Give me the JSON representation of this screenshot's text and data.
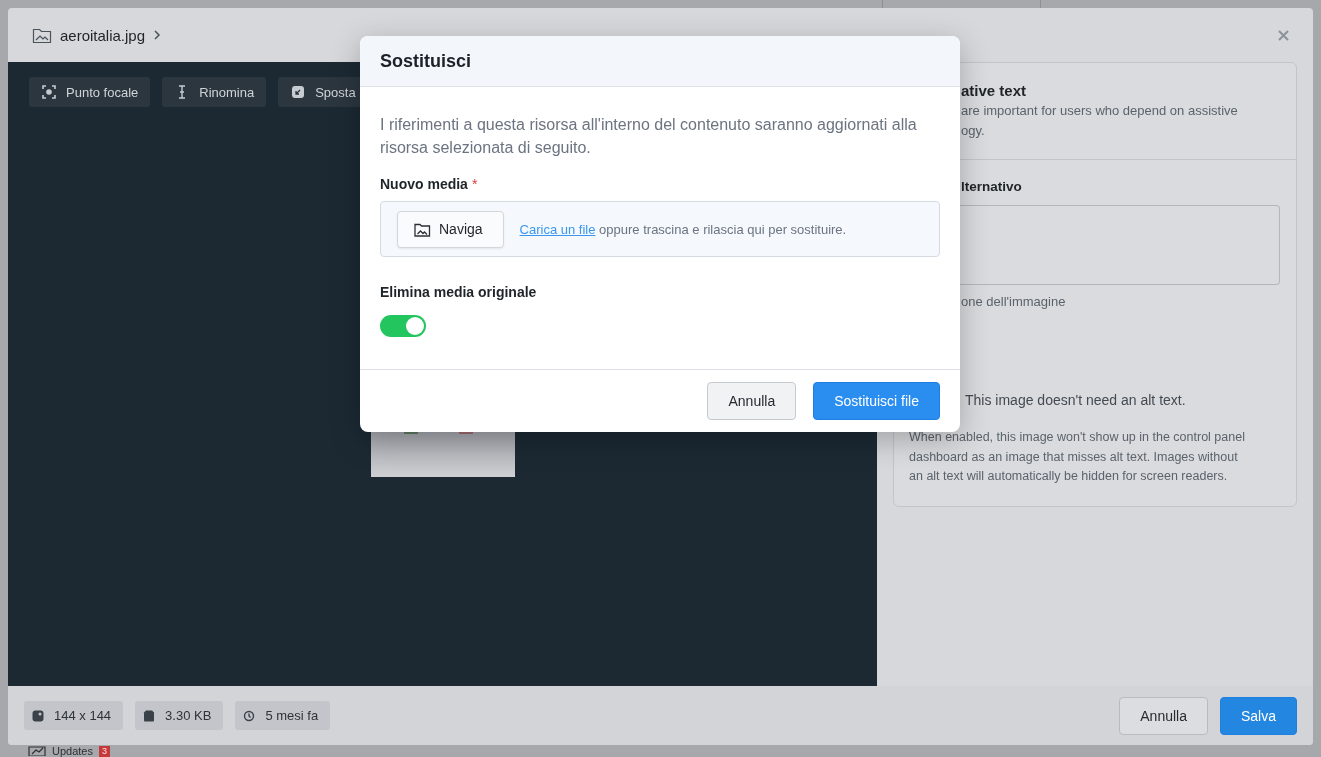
{
  "background": {
    "nav_item": {
      "label": "Updates",
      "badge": "3"
    }
  },
  "editor": {
    "breadcrumb": {
      "title": "aeroitalia.jpg"
    },
    "toolbar": [
      {
        "label": "Punto focale",
        "kind": "focus"
      },
      {
        "label": "Rinomina",
        "kind": "rename"
      },
      {
        "label": "Sposta",
        "kind": "move"
      }
    ],
    "alt_panel": {
      "title": "ative text",
      "description_lines": [
        "are important for users who depend on assistive",
        "ogy."
      ],
      "field_label": "lternativo",
      "field_hint": "one dell'immagine",
      "decorative_label": "This image doesn't need an alt text.",
      "decorative_help": "When enabled, this image won't show up in the control panel dashboard as an image that misses alt text. Images without an alt text will automatically be hidden for screen readers."
    },
    "meta": [
      {
        "label": "144 x 144",
        "kind": "dimensions"
      },
      {
        "label": "3.30 KB",
        "kind": "size"
      },
      {
        "label": "5 mesi fa",
        "kind": "age"
      }
    ],
    "buttons": [
      {
        "label": "Annulla",
        "kind": "secondary"
      },
      {
        "label": "Salva",
        "kind": "primary"
      }
    ]
  },
  "dialog": {
    "title": "Sostituisci",
    "description": "I riferimenti a questa risorsa all'interno del contenuto saranno aggiornati alla risorsa selezionata di seguito.",
    "media_label": "Nuovo media",
    "required_mark": "*",
    "browse_button": "Naviga",
    "upload_link": "Carica un file",
    "upload_hint": "oppure trascina e rilascia qui per sostituire.",
    "delete_original": {
      "label": "Elimina media originale",
      "on": true
    },
    "buttons": [
      {
        "label": "Annulla",
        "kind": "secondary"
      },
      {
        "label": "Sostituisci file",
        "kind": "primary"
      }
    ]
  }
}
